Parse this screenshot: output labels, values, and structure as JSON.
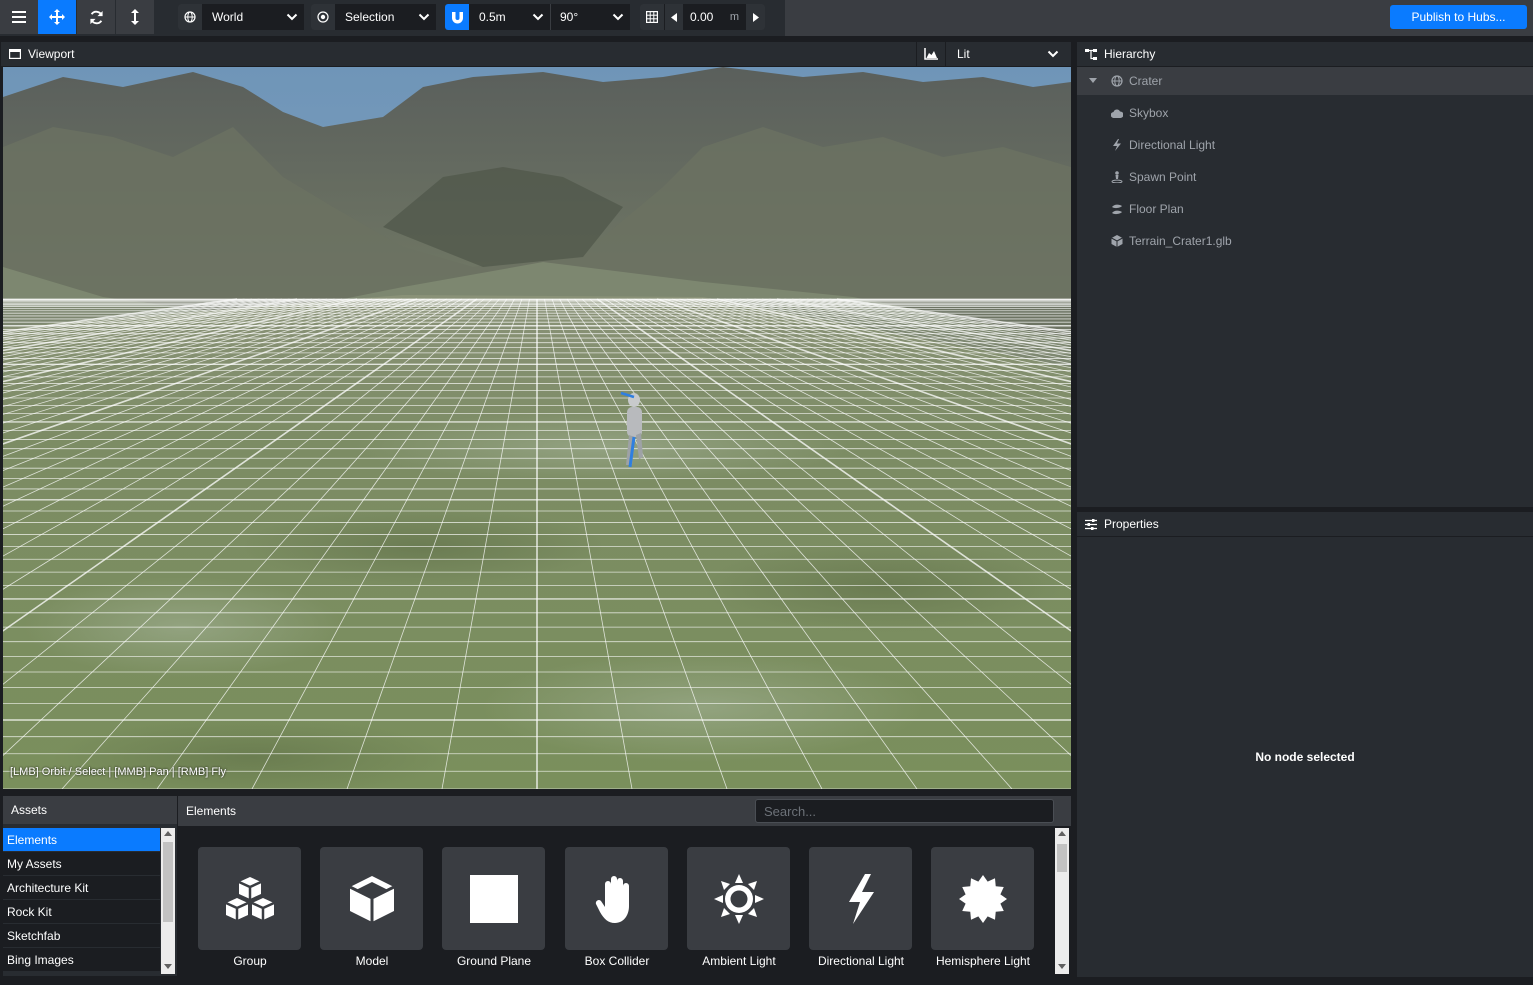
{
  "toolbar": {
    "transform_space": "World",
    "transform_pivot": "Selection",
    "snap_translation": "0.5m",
    "snap_rotation": "90°",
    "grid_height": "0.00",
    "grid_unit": "m",
    "publish_label": "Publish to Hubs..."
  },
  "viewport": {
    "title": "Viewport",
    "render_mode": "Lit",
    "controls_hint": "[LMB] Orbit / Select | [MMB] Pan | [RMB] Fly"
  },
  "hierarchy": {
    "title": "Hierarchy",
    "root": "Crater",
    "items": [
      {
        "label": "Skybox",
        "icon": "cloud-icon"
      },
      {
        "label": "Directional Light",
        "icon": "bolt-icon"
      },
      {
        "label": "Spawn Point",
        "icon": "person-icon"
      },
      {
        "label": "Floor Plan",
        "icon": "shoe-prints-icon"
      },
      {
        "label": "Terrain_Crater1.glb",
        "icon": "cube-icon"
      }
    ]
  },
  "properties": {
    "title": "Properties",
    "empty_message": "No node selected"
  },
  "assets": {
    "title": "Assets",
    "sources": [
      "Elements",
      "My Assets",
      "Architecture Kit",
      "Rock Kit",
      "Sketchfab",
      "Bing Images"
    ],
    "selected": "Elements"
  },
  "elements": {
    "title": "Elements",
    "search_placeholder": "Search...",
    "items": [
      {
        "label": "Group",
        "icon": "cubes-icon"
      },
      {
        "label": "Model",
        "icon": "cube-icon"
      },
      {
        "label": "Ground Plane",
        "icon": "square-icon"
      },
      {
        "label": "Box Collider",
        "icon": "hand-icon"
      },
      {
        "label": "Ambient Light",
        "icon": "sun-icon"
      },
      {
        "label": "Directional Light",
        "icon": "bolt-icon"
      },
      {
        "label": "Hemisphere Light",
        "icon": "certificate-icon"
      }
    ]
  },
  "colors": {
    "accent": "#0a7bff",
    "panel": "#282c31",
    "background": "#1b1d21"
  }
}
